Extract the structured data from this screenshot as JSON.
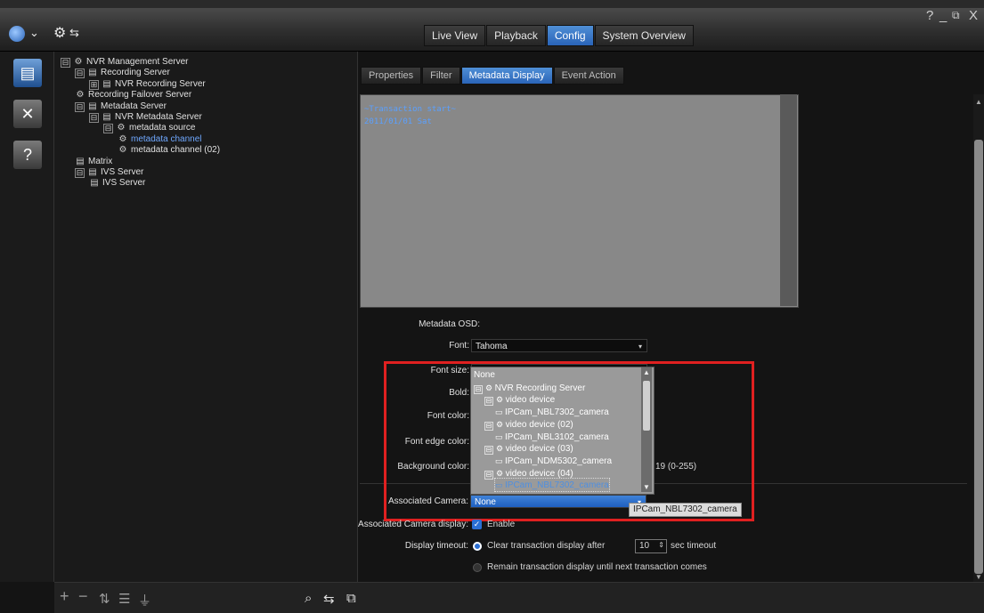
{
  "window": {
    "help": "?",
    "minimize": "_",
    "restore": "⧉",
    "close": "X"
  },
  "topbar": {
    "globe_icon": "globe-icon",
    "chevron": "⌄",
    "settings_icon": "⚙"
  },
  "nav": {
    "tabs": [
      {
        "label": "Live View",
        "active": false
      },
      {
        "label": "Playback",
        "active": false
      },
      {
        "label": "Config",
        "active": true
      },
      {
        "label": "System Overview",
        "active": false
      }
    ]
  },
  "rail": {
    "icons": [
      "server-icon",
      "tools-icon",
      "wallet-icon"
    ]
  },
  "tree": {
    "items": [
      {
        "label": "NVR Management Server",
        "toggle": "⊟",
        "depth": 0
      },
      {
        "label": "Recording Server",
        "toggle": "⊟",
        "depth": 1
      },
      {
        "label": "NVR Recording Server",
        "toggle": "⊞",
        "depth": 2
      },
      {
        "label": "Recording Failover Server",
        "toggle": "",
        "depth": 1
      },
      {
        "label": "Metadata Server",
        "toggle": "⊟",
        "depth": 1
      },
      {
        "label": "NVR Metadata Server",
        "toggle": "⊟",
        "depth": 2
      },
      {
        "label": "metadata source",
        "toggle": "⊟",
        "depth": 3
      },
      {
        "label": "metadata channel",
        "toggle": "",
        "depth": 4,
        "selected": true
      },
      {
        "label": "metadata channel (02)",
        "toggle": "",
        "depth": 4
      },
      {
        "label": "Matrix",
        "toggle": "",
        "depth": 1
      },
      {
        "label": "IVS Server",
        "toggle": "⊟",
        "depth": 1
      },
      {
        "label": "IVS Server",
        "toggle": "",
        "depth": 2
      }
    ]
  },
  "config": {
    "tabs": [
      {
        "label": "Properties",
        "active": false
      },
      {
        "label": "Filter",
        "active": false
      },
      {
        "label": "Metadata Display",
        "active": true
      },
      {
        "label": "Event Action",
        "active": false
      }
    ],
    "preview": {
      "line1": "~Transaction start~",
      "line2": "2011/01/01 Sat"
    },
    "osd_label": "Metadata OSD:",
    "font_label": "Font:",
    "font_value": "Tahoma",
    "font_size_label": "Font size:",
    "font_size_value": "10",
    "bold_label": "Bold:",
    "font_color_label": "Font color:",
    "font_edge_color_label": "Font edge color:",
    "background_color_label": "Background color:",
    "background_range": "19 (0-255)",
    "associated_camera_label": "Associated Camera:",
    "associated_camera_value": "None",
    "associated_display_label": "Associated Camera display:",
    "associated_display_value": "Enable",
    "display_timeout_label": "Display timeout:",
    "timeout_option1_pre": "Clear transaction display after",
    "timeout_value": "10",
    "timeout_option1_post": "sec timeout",
    "timeout_option2": "Remain transaction display until next transaction comes",
    "tooltip": "IPCam_NBL7302_camera"
  },
  "dropdown": {
    "items": [
      {
        "label": "None",
        "depth": 0,
        "toggle": ""
      },
      {
        "label": "NVR Recording Server",
        "depth": 0,
        "toggle": "⊟"
      },
      {
        "label": "video device",
        "depth": 1,
        "toggle": "⊟"
      },
      {
        "label": "IPCam_NBL7302_camera",
        "depth": 2,
        "toggle": ""
      },
      {
        "label": "video device (02)",
        "depth": 1,
        "toggle": "⊟"
      },
      {
        "label": "IPCam_NBL3102_camera",
        "depth": 2,
        "toggle": ""
      },
      {
        "label": "video device (03)",
        "depth": 1,
        "toggle": "⊟"
      },
      {
        "label": "IPCam_NDM5302_camera",
        "depth": 2,
        "toggle": ""
      },
      {
        "label": "video device (04)",
        "depth": 1,
        "toggle": "⊟"
      },
      {
        "label": "IPCam_NBL7302_camera",
        "depth": 2,
        "toggle": ""
      }
    ]
  },
  "bottombar": {
    "add": "+",
    "remove": "−",
    "sort": "⇅",
    "list": "☰",
    "filter": "⏚",
    "search": "⌕",
    "link": "⇆",
    "copy": "⧉"
  },
  "colors": {
    "accent": "#2a64b8",
    "highlight_box": "#e02020",
    "selected_text": "#6fa8ff"
  }
}
